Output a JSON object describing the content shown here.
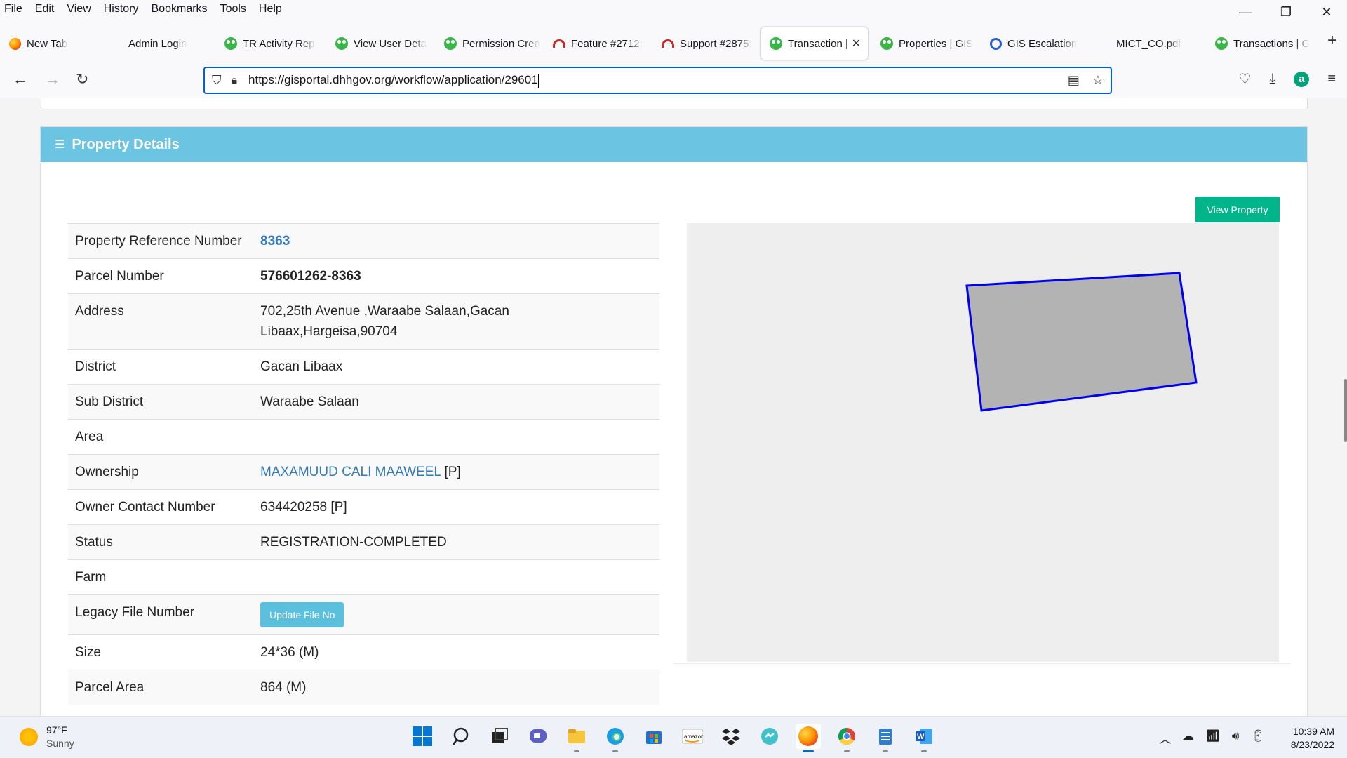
{
  "menu": [
    "File",
    "Edit",
    "View",
    "History",
    "Bookmarks",
    "Tools",
    "Help"
  ],
  "window_controls": {
    "minimize": "—",
    "restore": "❐",
    "close": "✕"
  },
  "tabs": [
    {
      "label": "New Tab",
      "icon": "firefox-icon"
    },
    {
      "label": "Admin Login",
      "icon": "none"
    },
    {
      "label": "TR Activity Rep",
      "icon": "gis-icon"
    },
    {
      "label": "View User Deta",
      "icon": "gis-icon"
    },
    {
      "label": "Permission Crea",
      "icon": "gis-icon"
    },
    {
      "label": "Feature #2712:",
      "icon": "redmine-icon"
    },
    {
      "label": "Support #2875:",
      "icon": "redmine-icon"
    },
    {
      "label": "Transaction |",
      "icon": "gis-icon",
      "active": true
    },
    {
      "label": "Properties | GIS",
      "icon": "gis-icon"
    },
    {
      "label": "GIS Escalation",
      "icon": "blue-ring-icon"
    },
    {
      "label": "MICT_CO.pdf",
      "icon": "none"
    },
    {
      "label": "Transactions | G",
      "icon": "gis-icon"
    }
  ],
  "url": "https://gisportal.dhhgov.org/workflow/application/29601",
  "panel": {
    "title": "Property Details",
    "view_property_label": "View Property"
  },
  "details": {
    "property_ref_label": "Property Reference Number",
    "property_ref_value": "8363",
    "parcel_label": "Parcel Number",
    "parcel_value": "576601262-8363",
    "address_label": "Address",
    "address_line1": "702,25th Avenue ,Waraabe Salaan,Gacan",
    "address_line2": "Libaax,Hargeisa,90704",
    "district_label": "District",
    "district_value": "Gacan Libaax",
    "subdistrict_label": "Sub District",
    "subdistrict_value": "Waraabe Salaan",
    "area_label": "Area",
    "area_value": "",
    "ownership_label": "Ownership",
    "ownership_name": "MAXAMUUD CALI MAAWEEL",
    "ownership_suffix": " [P]",
    "contact_label": "Owner Contact Number",
    "contact_value": "634420258 [P]",
    "status_label": "Status",
    "status_value": "REGISTRATION-COMPLETED",
    "farm_label": "Farm",
    "farm_value": "",
    "legacy_label": "Legacy File Number",
    "legacy_button": "Update File No",
    "size_label": "Size",
    "size_value": "24*36 (M)",
    "parcel_area_label": "Parcel Area",
    "parcel_area_value": "864 (M)"
  },
  "map": {
    "fill": "#b3b3b3",
    "stroke": "#0000ee",
    "background": "#eeeeee"
  },
  "taskbar": {
    "temperature": "97°F",
    "condition": "Sunny",
    "time": "10:39 AM",
    "date": "8/23/2022"
  },
  "colors": {
    "panel_header": "#6ac4e2",
    "view_property": "#00b58a",
    "update_button": "#5bc0de",
    "link": "#337ab7"
  }
}
